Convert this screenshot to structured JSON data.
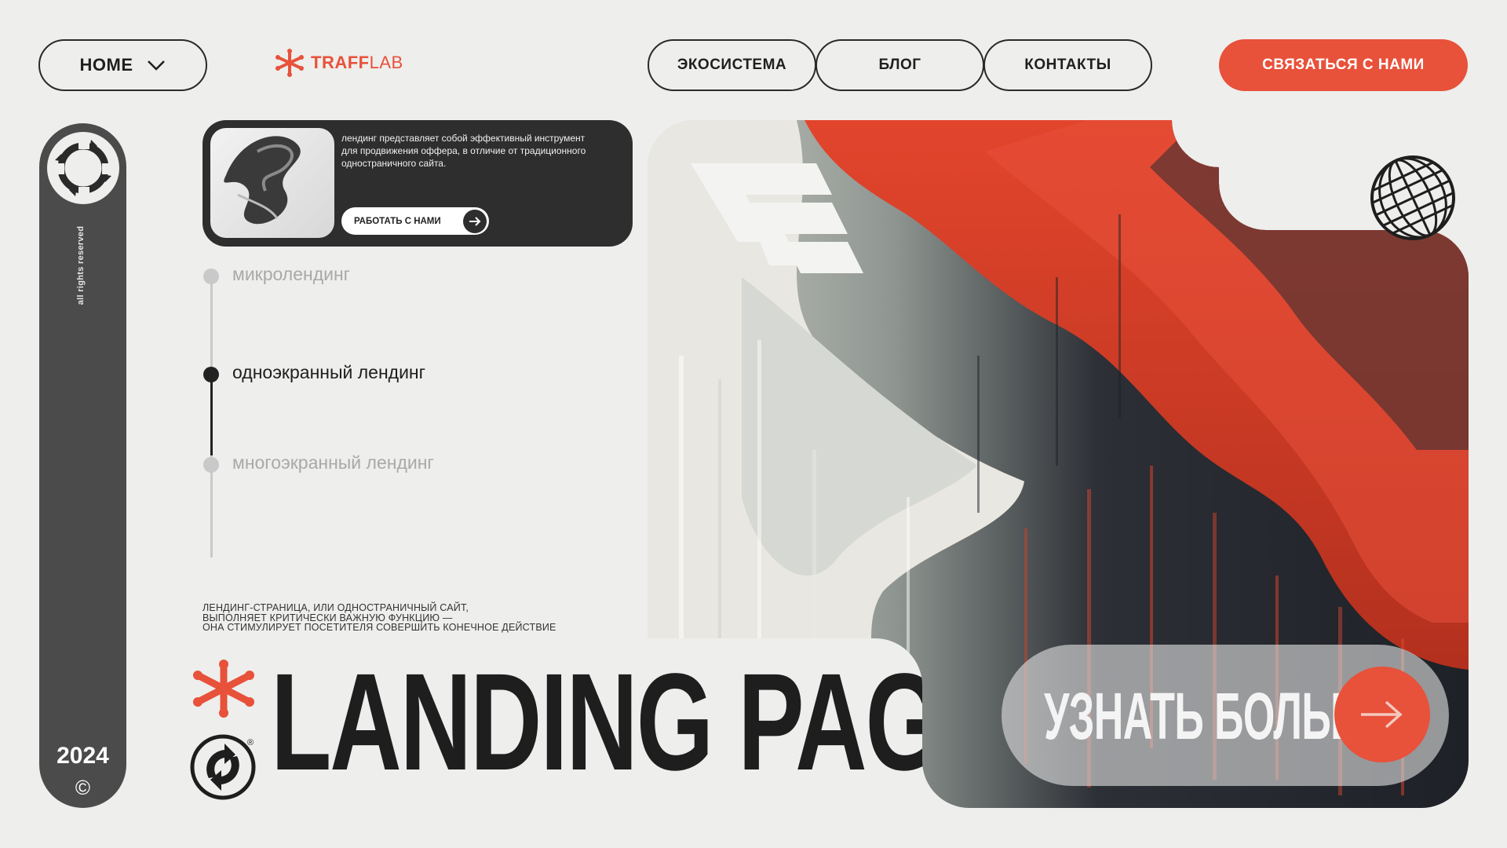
{
  "nav": {
    "home_label": "HOME",
    "logo_bold": "TRAFF",
    "logo_light": "LAB",
    "links": [
      "ЭКОСИСТЕМА",
      "БЛОГ",
      "КОНТАКТЫ"
    ],
    "cta_label": "СВЯЗАТЬСЯ С НАМИ"
  },
  "sidebar": {
    "rotated_text": "all rights reserved",
    "year": "2024",
    "copyright": "©"
  },
  "info_card": {
    "text": "лендинг представляет собой эффективный инструмент для продвижения оффера, в отличие от традиционного одностраничного сайта.",
    "button_label": "РАБОТАТЬ С НАМИ"
  },
  "types": {
    "items": [
      "микролендинг",
      "одноэкранный лендинг",
      "многоэкранный лендинг"
    ],
    "active_index": 1
  },
  "description": {
    "line1": "ЛЕНДИНГ-СТРАНИЦА, ИЛИ ОДНОСТРАНИЧНЫЙ САЙТ,",
    "line2": "ВЫПОЛНЯЕТ КРИТИЧЕСКИ ВАЖНУЮ ФУНКЦИЮ —",
    "line3": "ОНА СТИМУЛИРУЕТ ПОСЕТИТЕЛЯ СОВЕРШИТЬ КОНЕЧНОЕ ДЕЙСТВИЕ"
  },
  "headline": {
    "title": "LANDING PAGE",
    "registered_mark": "®"
  },
  "hero": {
    "more_label": "УЗНАТЬ БОЛЬШЕ"
  },
  "colors": {
    "accent": "#e8513a",
    "dark": "#2e2e2e",
    "background": "#eeeeec"
  },
  "icons": [
    "chevron-down-icon",
    "trafflab-asterisk-icon",
    "rotate-arrows-icon",
    "arrow-right-icon",
    "asterisk-icon",
    "recycle-icon",
    "globe-icon",
    "brand-mark-icon"
  ]
}
